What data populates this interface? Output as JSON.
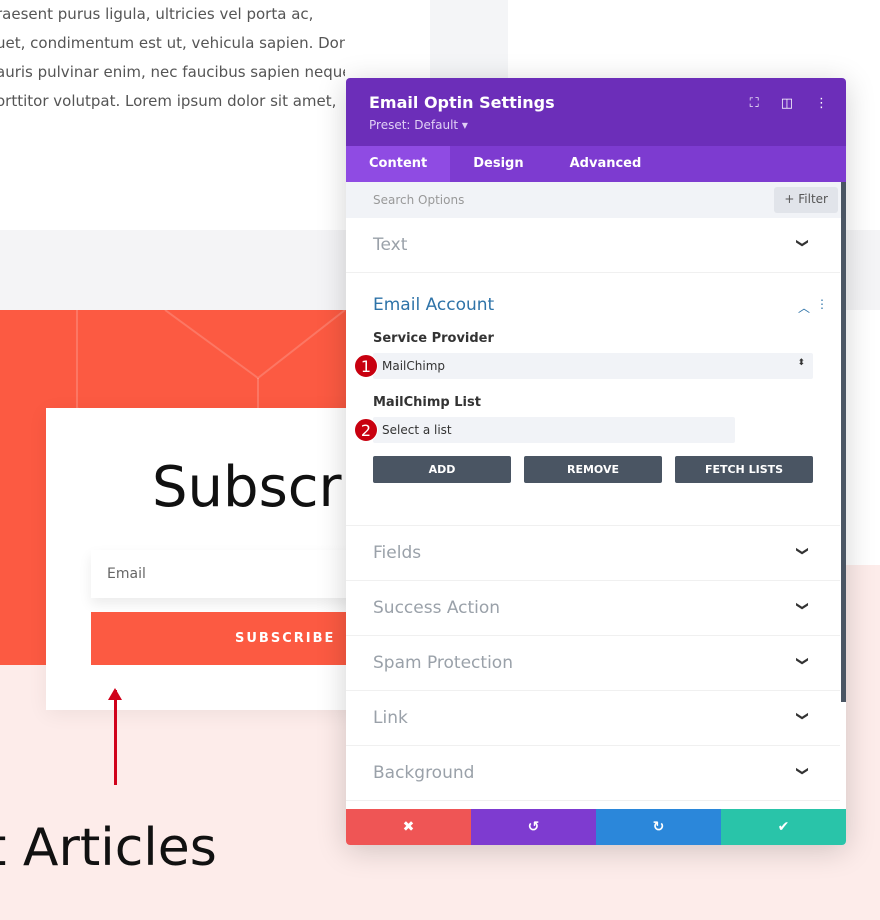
{
  "page": {
    "paragraph": [
      "raesent purus ligula, ultricies vel porta ac,",
      "uet, condimentum est ut, vehicula sapien. Donec",
      "auris pulvinar enim, nec faucibus sapien neque",
      "orttitor volutpat. Lorem ipsum dolor sit amet,"
    ],
    "subscribe_heading": "Subscrib",
    "email_placeholder": "Email",
    "subscribe_button": "SUBSCRIBE",
    "articles_heading": "t Articles",
    "accent_color": "#fc5a42"
  },
  "panel": {
    "title": "Email Optin Settings",
    "preset": "Preset: Default ▾",
    "header_icons": [
      "fullscreen-icon",
      "split-view-icon",
      "more-vertical-icon"
    ],
    "tabs": [
      {
        "label": "Content",
        "active": true
      },
      {
        "label": "Design"
      },
      {
        "label": "Advanced"
      }
    ],
    "search_placeholder": "Search Options",
    "filter_label": "+ Filter",
    "sections_top": [
      "Text"
    ],
    "email_account": {
      "title": "Email Account",
      "service_provider_label": "Service Provider",
      "service_provider_value": "MailChimp",
      "list_label": "MailChimp List",
      "list_value": "Select a list",
      "badges": [
        "1",
        "2"
      ],
      "buttons": [
        "ADD",
        "REMOVE",
        "FETCH LISTS"
      ]
    },
    "sections_bottom": [
      "Fields",
      "Success Action",
      "Spam Protection",
      "Link",
      "Background"
    ],
    "footer": {
      "cancel": "✖",
      "undo": "↺",
      "redo": "↻",
      "save": "✔",
      "colors": [
        "#ef5555",
        "#7e3bd0",
        "#2b87da",
        "#29c4a9"
      ]
    }
  }
}
